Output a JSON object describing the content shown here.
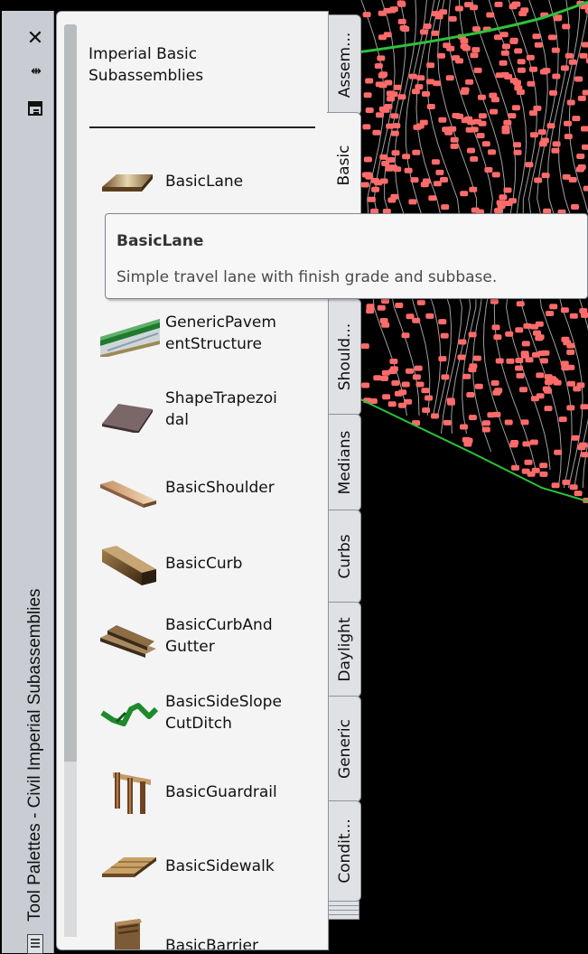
{
  "window": {
    "strip_title": "Tool Palettes - Civil Imperial Subassemblies",
    "close_glyph": "✕",
    "autohide_glyph": "⇹"
  },
  "palette": {
    "heading": "Imperial Basic Subassemblies",
    "tools": [
      {
        "label": "BasicLane",
        "icon": "basic-lane-icon"
      },
      {
        "label": "GenericPavementStructure",
        "icon": "generic-pavement-icon"
      },
      {
        "label": "ShapeTrapezoidal",
        "icon": "shape-trapezoidal-icon"
      },
      {
        "label": "BasicShoulder",
        "icon": "basic-shoulder-icon"
      },
      {
        "label": "BasicCurb",
        "icon": "basic-curb-icon"
      },
      {
        "label": "BasicCurbAndGutter",
        "icon": "basic-curb-and-gutter-icon"
      },
      {
        "label": "BasicSideSlopeCutDitch",
        "icon": "basic-side-slope-cut-ditch-icon"
      },
      {
        "label": "BasicGuardrail",
        "icon": "basic-guardrail-icon"
      },
      {
        "label": "BasicSidewalk",
        "icon": "basic-sidewalk-icon"
      },
      {
        "label": "BasicBarrier",
        "icon": "basic-barrier-icon"
      }
    ],
    "tool_labels_wrapped": {
      "generic_line1": "GenericPavem",
      "generic_line2": "entStructure",
      "shape_line1": "ShapeTrapezoi",
      "shape_line2": "dal",
      "curbgutter_line1": "BasicCurbAnd",
      "curbgutter_line2": "Gutter",
      "sideslope_line1": "BasicSideSlope",
      "sideslope_line2": "CutDitch",
      "barrier_partial": "BasicBarrier"
    }
  },
  "tabs": [
    {
      "label": "Assem..."
    },
    {
      "label": "Basic",
      "active": true
    },
    {
      "label": "Should..."
    },
    {
      "label": "Medians"
    },
    {
      "label": "Curbs"
    },
    {
      "label": "Daylight"
    },
    {
      "label": "Generic"
    },
    {
      "label": "Condit..."
    }
  ],
  "tooltip": {
    "title": "BasicLane",
    "description": "Simple travel lane with finish grade and subbase."
  },
  "colors": {
    "contour_line": "#c8c8c8",
    "point_marker": "#ff6b6b",
    "boundary_line": "#2ec13a",
    "background": "#000000"
  }
}
